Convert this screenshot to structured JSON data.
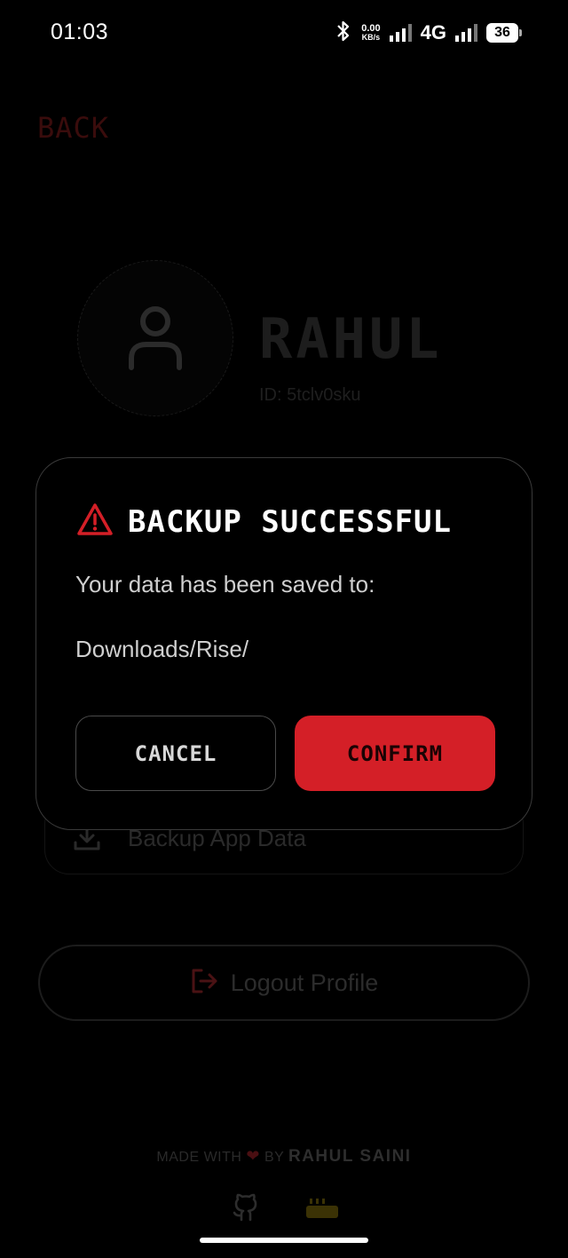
{
  "status_bar": {
    "time": "01:03",
    "net_speed_value": "0.00",
    "net_speed_unit": "KB/s",
    "network": "4G",
    "battery": "36",
    "icons": [
      "bluetooth-icon",
      "signal-icon",
      "signal-icon",
      "battery-icon"
    ]
  },
  "page": {
    "back_label": "BACK",
    "profile": {
      "name": "RAHUL",
      "id_text": "ID: 5tclv0sku"
    },
    "backup_label": "Backup App Data",
    "logout_label": "Logout Profile",
    "footer": {
      "made_with": "MADE WITH",
      "heart": "❤",
      "by": "BY",
      "author": "RAHUL SAINI"
    }
  },
  "dialog": {
    "title": "BACKUP SUCCESSFUL",
    "message": "Your data has been saved to:",
    "path": "Downloads/Rise/",
    "cancel_label": "CANCEL",
    "confirm_label": "CONFIRM"
  },
  "colors": {
    "accent_red": "#d41f27",
    "background": "#000000",
    "dialog_border": "#3a3a3a"
  }
}
